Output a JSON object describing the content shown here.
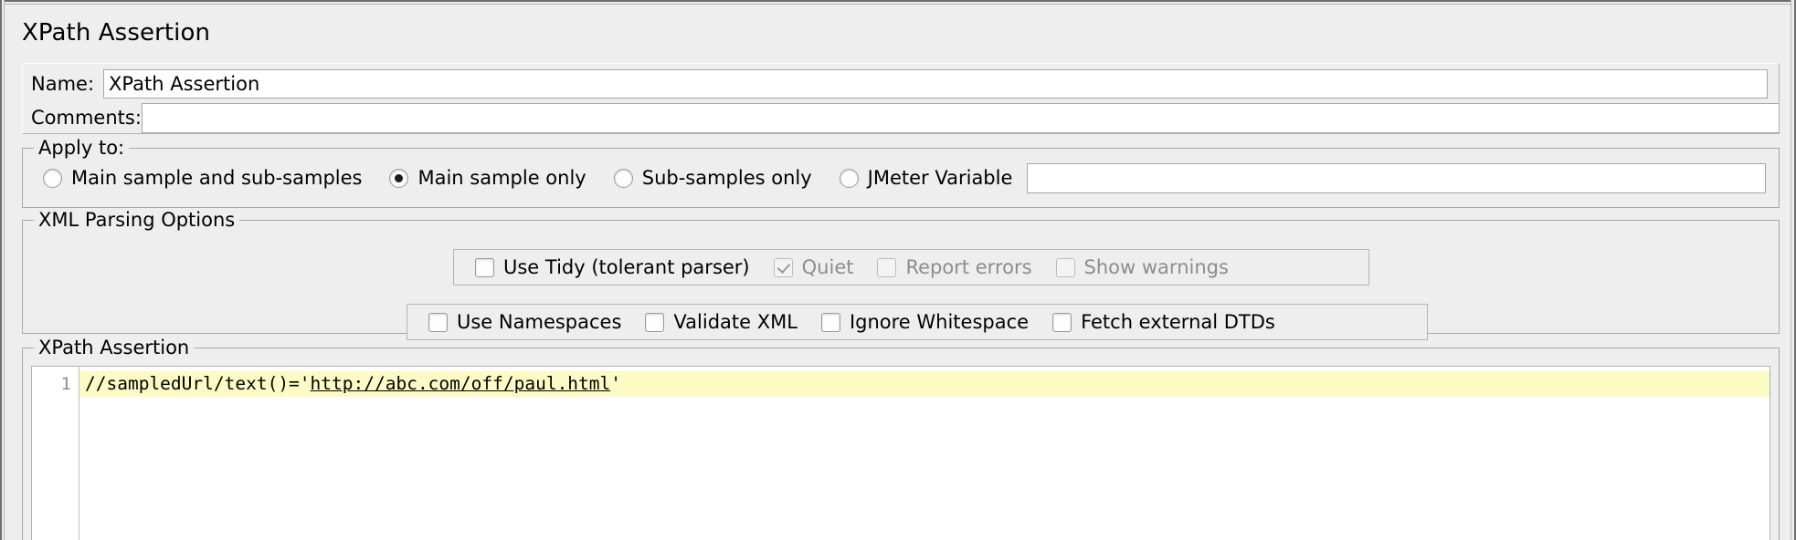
{
  "window": {
    "title": "XPath Assertion"
  },
  "name_row": {
    "label": "Name:",
    "value": "XPath Assertion",
    "placeholder": ""
  },
  "comments_row": {
    "label": "Comments:",
    "value": "",
    "placeholder": ""
  },
  "apply_to": {
    "group_title": "Apply to:",
    "options": [
      {
        "label": "Main sample and sub-samples",
        "checked": false
      },
      {
        "label": "Main sample only",
        "checked": true
      },
      {
        "label": "Sub-samples only",
        "checked": false
      },
      {
        "label": "JMeter Variable",
        "checked": false
      }
    ],
    "variable_field": {
      "value": "",
      "placeholder": ""
    }
  },
  "xml_parsing": {
    "group_title": "XML Parsing Options",
    "row1": [
      {
        "label": "Use Tidy (tolerant parser)",
        "checked": false,
        "disabled": false
      },
      {
        "label": "Quiet",
        "checked": true,
        "disabled": true
      },
      {
        "label": "Report errors",
        "checked": false,
        "disabled": true
      },
      {
        "label": "Show warnings",
        "checked": false,
        "disabled": true
      }
    ],
    "row2": [
      {
        "label": "Use Namespaces",
        "checked": false,
        "disabled": false
      },
      {
        "label": "Validate XML",
        "checked": false,
        "disabled": false
      },
      {
        "label": "Ignore Whitespace",
        "checked": false,
        "disabled": false
      },
      {
        "label": "Fetch external DTDs",
        "checked": false,
        "disabled": false
      }
    ]
  },
  "xpath_assertion": {
    "group_title": "XPath Assertion",
    "editor": {
      "line_number": "1",
      "code_prefix": "//sampledUrl/text()='",
      "code_url": "http://abc.com/off/paul.html",
      "code_suffix": "'",
      "highlight_color": "#fdfbc4"
    }
  },
  "colors": {
    "panel_background": "#eeeeee",
    "border": "#a9a9a9",
    "field_background": "#ffffff",
    "disabled_text": "#8d8d8d",
    "current_line": "#fdfbc4"
  }
}
